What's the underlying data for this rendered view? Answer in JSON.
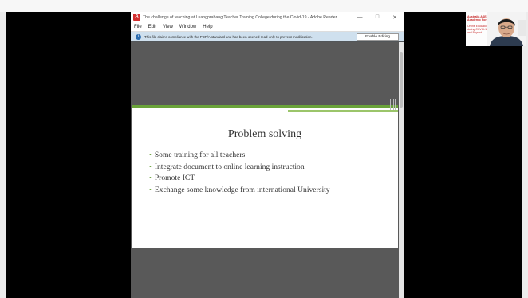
{
  "window": {
    "title": "The challenge of teaching at Luangprabang Teacher Training College during the Covid-19 - Adobe Reader",
    "controls": [
      "minimize-icon",
      "maximize-icon",
      "close-icon"
    ],
    "accent_color": "#d32f2f"
  },
  "menu": {
    "items": [
      "File",
      "Edit",
      "View",
      "Window",
      "Help"
    ]
  },
  "infobar": {
    "message": "This file claims compliance with the PDF/A standard and has been opened read-only to prevent modification.",
    "button_label": "Enable Editing",
    "icon": "info-icon"
  },
  "slide": {
    "title": "Problem solving",
    "bullets": [
      "Some training for all teachers",
      "Integrate document to online learning instruction",
      "Promote ICT",
      "Exchange some knowledge from international University"
    ],
    "accent_color": "#6aa33a"
  },
  "webcam": {
    "brand": "Australia ASEAN Academic Forum",
    "subtitle": "Online Education during COVID-19 and Beyond"
  }
}
